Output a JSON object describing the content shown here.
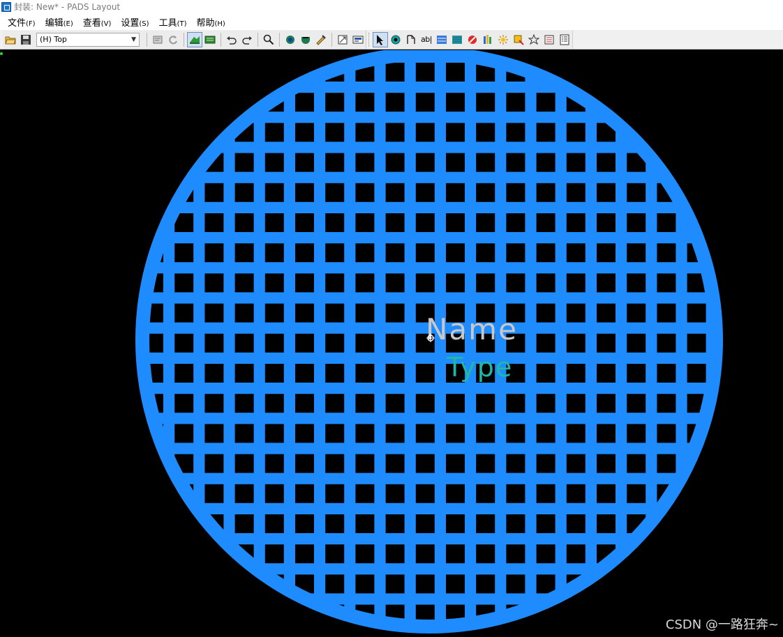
{
  "window": {
    "title": "封装: New* - PADS Layout"
  },
  "menu": {
    "items": [
      {
        "label": "文件",
        "accel": "(F)"
      },
      {
        "label": "编辑",
        "accel": "(E)"
      },
      {
        "label": "查看",
        "accel": "(V)"
      },
      {
        "label": "设置",
        "accel": "(S)"
      },
      {
        "label": "工具",
        "accel": "(T)"
      },
      {
        "label": "帮助",
        "accel": "(H)"
      }
    ]
  },
  "toolbar": {
    "layer_select": "(H) Top",
    "icons": [
      "open-folder-icon",
      "save-icon",
      "properties-icon",
      "refresh-icon",
      "drafting-mode-icon",
      "decal-mode-icon",
      "undo-icon",
      "redo-icon",
      "zoom-icon",
      "view-icon-1",
      "view-icon-2",
      "view-icon-3",
      "pad-stack-icon",
      "wizard-icon",
      "select-icon",
      "terminal-icon",
      "attr-label-icon",
      "text-icon",
      "2d-line-icon",
      "copper-icon",
      "cutout-icon",
      "pour-icon",
      "hatch-icon",
      "flood-icon",
      "plane-icon",
      "assign-icon",
      "report-icon"
    ],
    "text_tool_label": "ab|"
  },
  "canvas": {
    "background": "#000000",
    "hatch_color": "#1e8cff",
    "name_label": "Name",
    "type_label": "Type",
    "name_color": "#c8c8c8",
    "type_color": "#1fb8a8"
  },
  "watermark": "CSDN @一路狂奔~"
}
